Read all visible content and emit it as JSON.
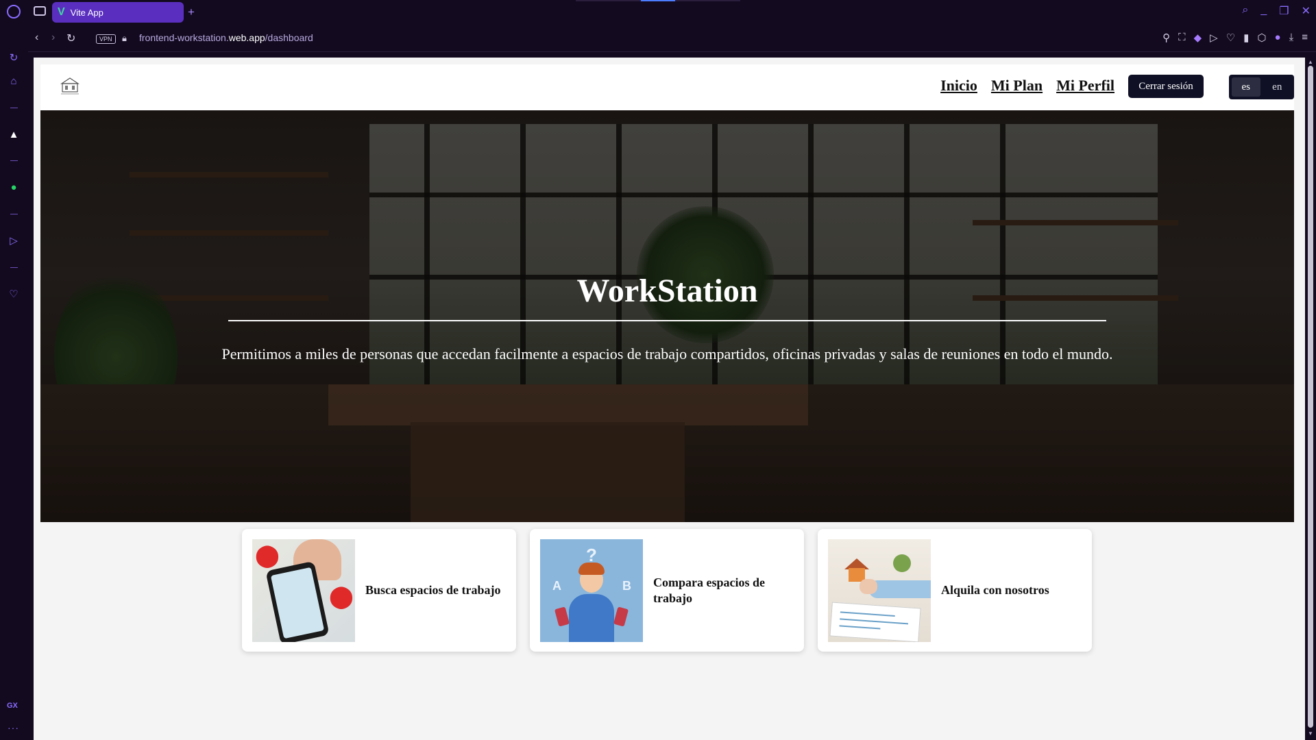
{
  "browser": {
    "tab_title": "Vite App",
    "new_tab_label": "+",
    "vpn_label": "VPN",
    "url_prefix": "frontend-workstation.",
    "url_domain": "web.app",
    "url_path": "/dashboard",
    "rail_label": "GX",
    "rail_more": "···"
  },
  "header": {
    "nav": [
      "Inicio",
      "Mi Plan",
      "Mi Perfil"
    ],
    "logout_label": "Cerrar sesión",
    "languages": [
      "es",
      "en"
    ],
    "active_language": "es"
  },
  "hero": {
    "title": "WorkStation",
    "tagline": "Permitimos a miles de personas que accedan facilmente a espacios de trabajo compartidos, oficinas privadas y salas de reuniones en todo el mundo."
  },
  "cards": [
    {
      "title": "Busca espacios de trabajo",
      "image_icon": "map-pin-phone"
    },
    {
      "title": "Compara espacios de trabajo",
      "image_icon": "person-comparing"
    },
    {
      "title": "Alquila con nosotros",
      "image_icon": "house-contract"
    }
  ],
  "colors": {
    "browser_bg": "#130a1f",
    "tab_active": "#5a2fc0",
    "accent": "#8a6cff",
    "button_dark": "#0f1025",
    "page_bg": "#f4f4f4"
  }
}
